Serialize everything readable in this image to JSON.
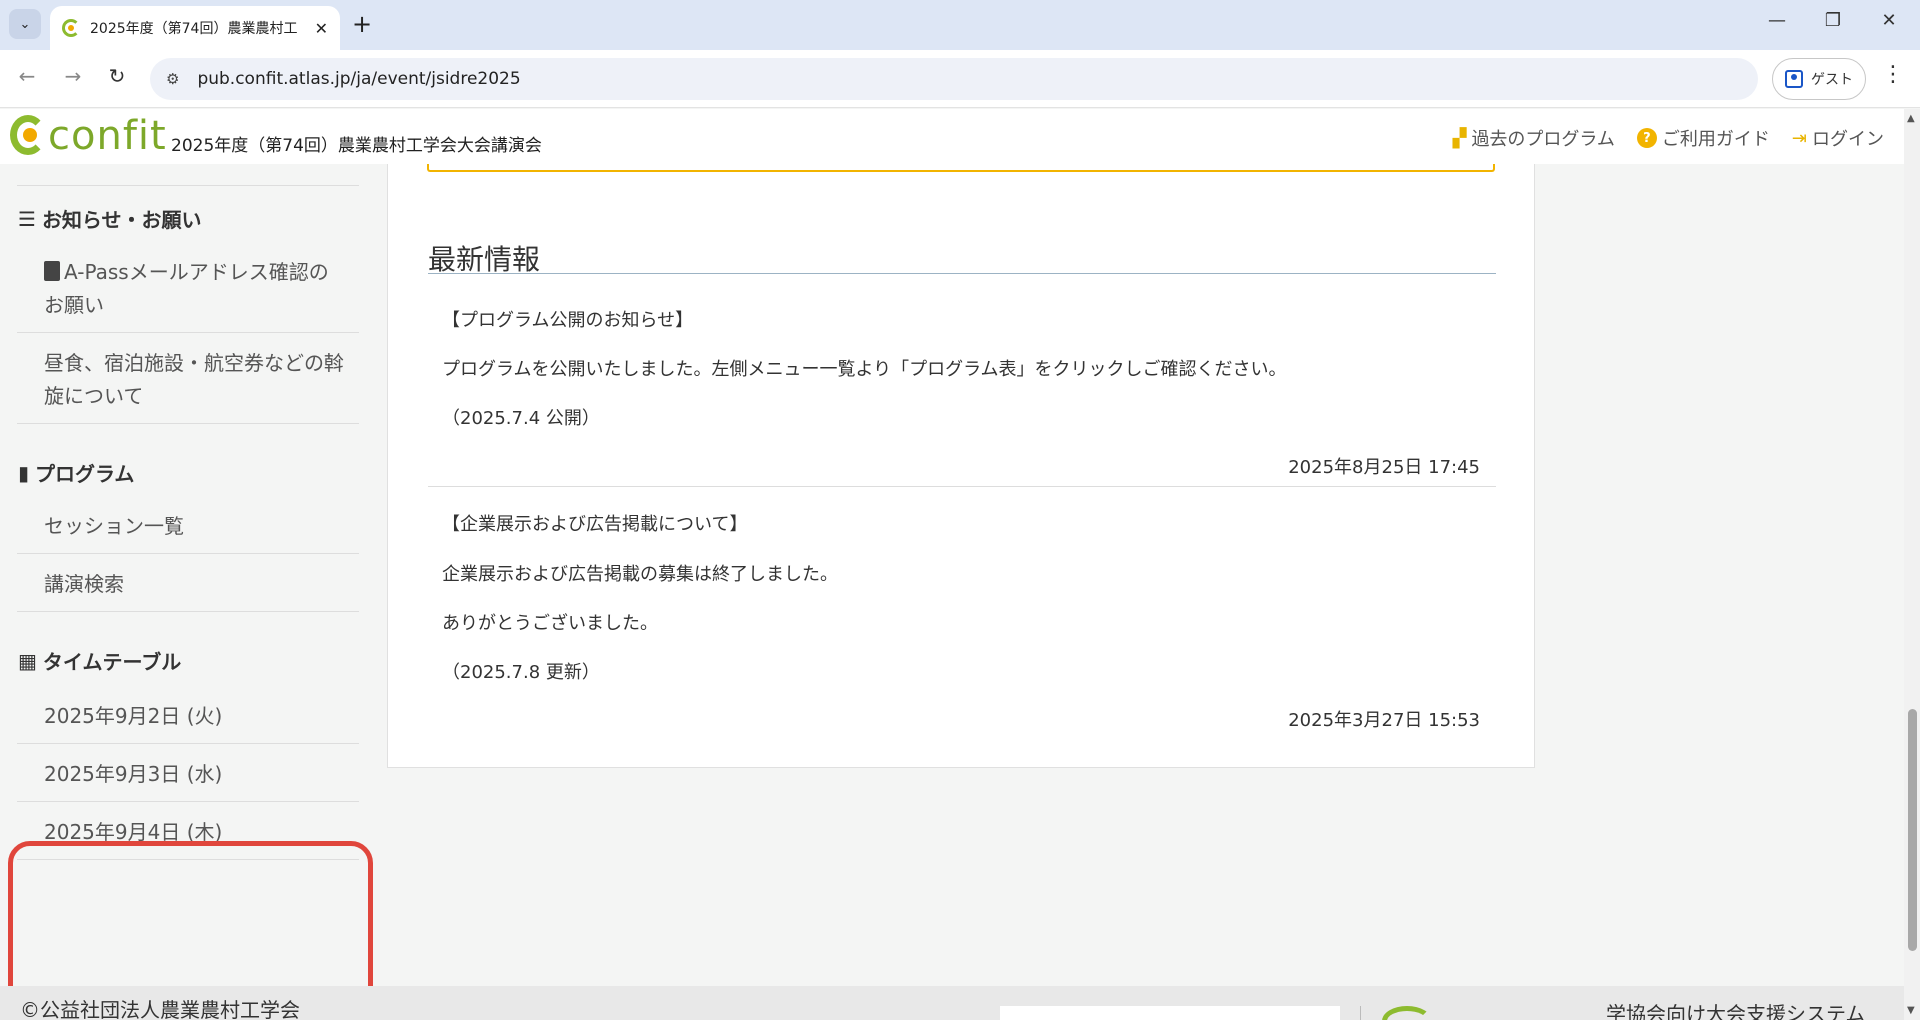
{
  "browser": {
    "tab_title": "2025年度（第74回）農業農村工",
    "url": "pub.confit.atlas.jp/ja/event/jsidre2025",
    "guest_label": "ゲスト"
  },
  "header": {
    "logo_text": "confit",
    "site_title": "2025年度（第74回）農業農村工学会大会講演会",
    "links": {
      "past_programs": "過去のプログラム",
      "guide": "ご利用ガイド",
      "login": "ログイン"
    }
  },
  "sidebar": {
    "notices_heading": "お知らせ・お願い",
    "notice_items": [
      "A-Passメールアドレス確認のお願い",
      "昼食、宿泊施設・航空券などの斡旋について"
    ],
    "program_heading": "プログラム",
    "program_items": [
      "セッション一覧",
      "講演検索"
    ],
    "timetable_heading": "タイムテーブル",
    "timetable_items": [
      "2025年9月2日 (火)",
      "2025年9月3日 (水)",
      "2025年9月4日 (木)"
    ]
  },
  "news": {
    "heading": "最新情報",
    "items": [
      {
        "title": "【プログラム公開のお知らせ】",
        "lines": [
          "プログラムを公開いたしました。左側メニュー一覧より「プログラム表」をクリックしご確認ください。",
          "（2025.7.4 公開）"
        ],
        "date": "2025年8月25日 17:45"
      },
      {
        "title": "【企業展示および広告掲載について】",
        "lines": [
          "企業展示および広告掲載の募集は終了しました。",
          "ありがとうございました。",
          "（2025.7.8 更新）"
        ],
        "date": "2025年3月27日 15:53"
      }
    ]
  },
  "footer": {
    "copyright": "©公益社団法人農業農村工学会",
    "right_text": "学協会向け大会支援システム"
  },
  "colors": {
    "accent_yellow": "#f2b400",
    "logo_green": "#8dbb2f",
    "highlight_red": "#e0463c"
  }
}
